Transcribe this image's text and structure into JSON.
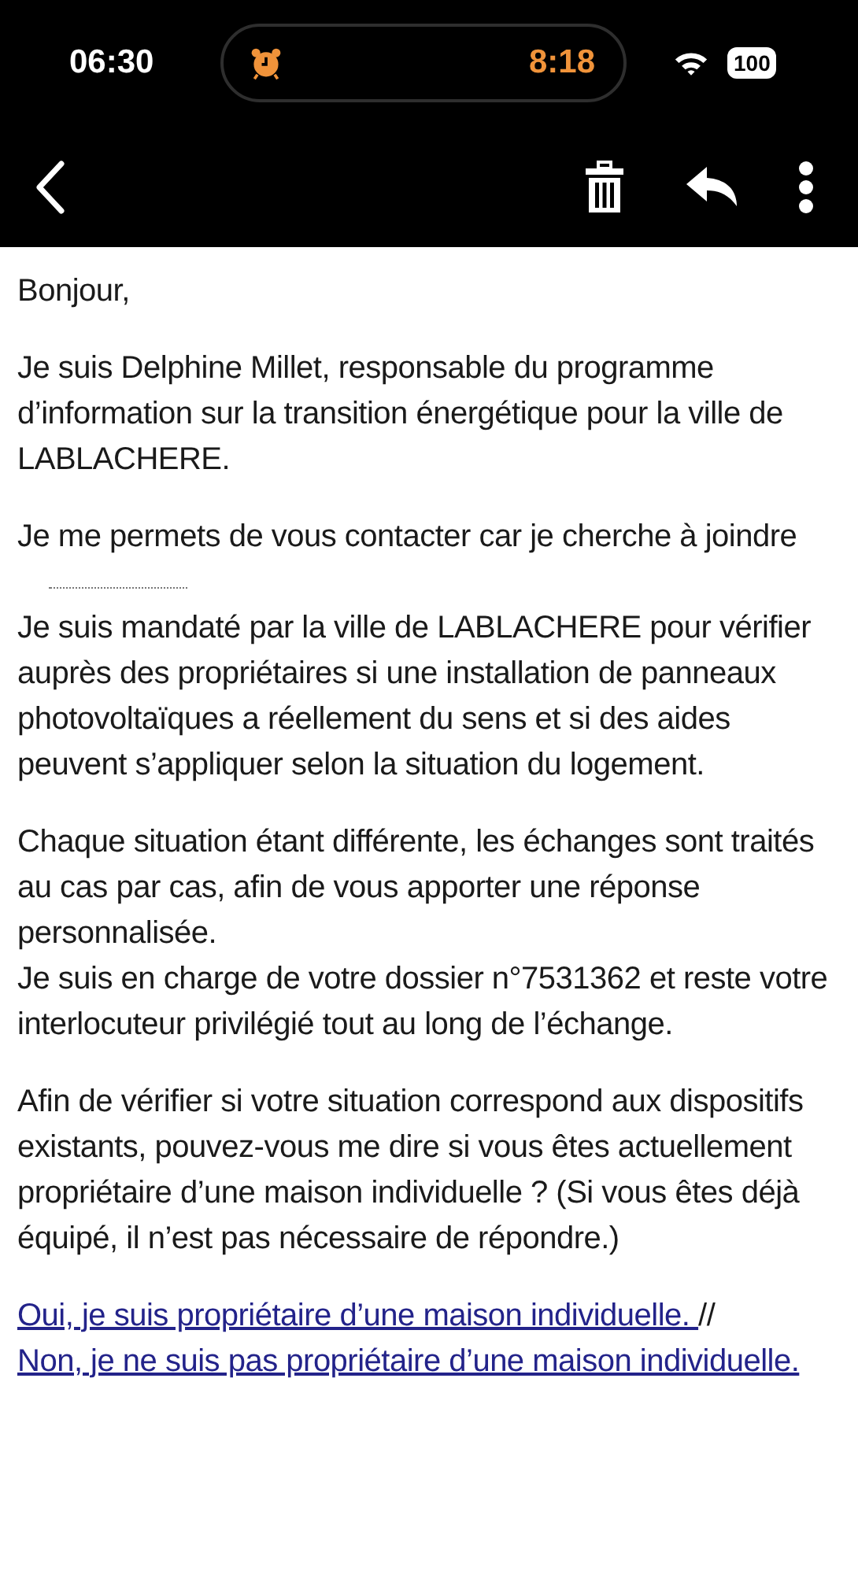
{
  "status_bar": {
    "time": "06:30",
    "activity_time": "8:18",
    "battery": "100"
  },
  "email": {
    "paragraphs": [
      {
        "lines": [
          {
            "text": "Bonjour,"
          }
        ]
      },
      {
        "lines": [
          {
            "text": "Je suis Delphine Millet, responsable du programme d’information sur la transition énergétique pour la ville de LABLACHERE."
          }
        ]
      },
      {
        "lines": [
          {
            "text": "Je me permets de vous contacter car je cherche à joindre",
            "blank": true
          },
          {
            "text": "Je suis mandaté par la ville de LABLACHERE pour vérifier auprès des propriétaires si une installation de panneaux photovoltaïques a réellement du sens et si des aides peuvent s’appliquer selon la situation du logement."
          }
        ]
      },
      {
        "lines": [
          {
            "text": "Chaque situation étant différente, les échanges sont traités au cas par cas, afin de vous apporter une réponse personnalisée."
          },
          {
            "text": "Je suis en charge de votre dossier n°7531362 et reste votre interlocuteur privilégié tout au long de l’échange."
          }
        ]
      },
      {
        "lines": [
          {
            "text": "Afin de vérifier si votre situation correspond aux dispositifs existants, pouvez-vous me dire si vous êtes actuellement propriétaire d’une maison individuelle ? (Si vous êtes déjà équipé, il n’est pas nécessaire de répondre.)"
          }
        ]
      }
    ],
    "links": [
      {
        "text": "Oui, je suis propriétaire d’une maison individuelle. "
      },
      {
        "text": "Non, je ne suis pas propriétaire d’une maison individuelle."
      }
    ],
    "separator": "//"
  }
}
